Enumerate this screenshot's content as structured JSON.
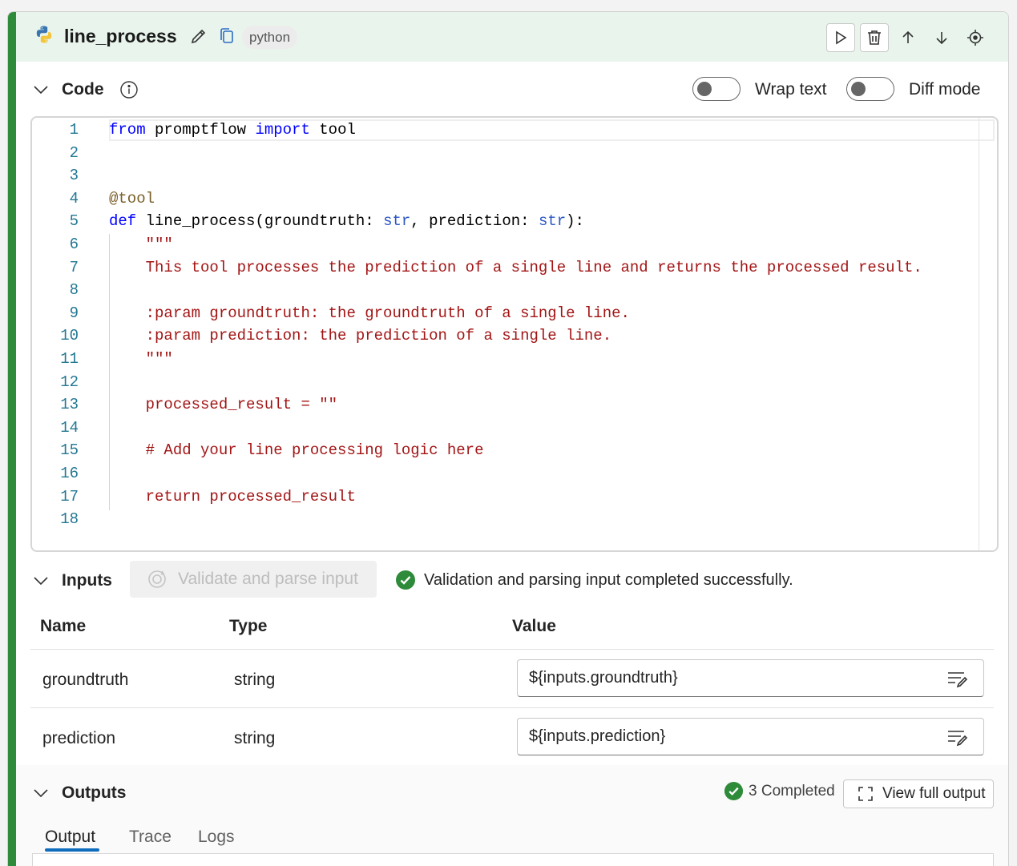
{
  "node": {
    "title": "line_process",
    "language": "python"
  },
  "code_section": {
    "title": "Code",
    "wrap_label": "Wrap text",
    "diff_label": "Diff mode",
    "wrap_on": false,
    "diff_on": false
  },
  "code_lines": [
    "from promptflow import tool",
    "",
    "",
    "@tool",
    "def line_process(groundtruth: str, prediction: str):",
    "    \"\"\"",
    "    This tool processes the prediction of a single line and returns the processed result.",
    "",
    "    :param groundtruth: the groundtruth of a single line.",
    "    :param prediction: the prediction of a single line.",
    "    \"\"\"",
    "",
    "    processed_result = \"\"",
    "",
    "    # Add your line processing logic here",
    "",
    "    return processed_result",
    ""
  ],
  "inputs_section": {
    "title": "Inputs",
    "validate_label": "Validate and parse input",
    "status": "Validation and parsing input completed successfully.",
    "columns": [
      "Name",
      "Type",
      "Value"
    ],
    "rows": [
      {
        "name": "groundtruth",
        "type": "string",
        "value": "${inputs.groundtruth}"
      },
      {
        "name": "prediction",
        "type": "string",
        "value": "${inputs.prediction}"
      }
    ]
  },
  "outputs_section": {
    "title": "Outputs",
    "completed": "3 Completed",
    "view_full": "View full output",
    "tabs": [
      "Output",
      "Trace",
      "Logs"
    ],
    "active_tab": "Output"
  },
  "colors": {
    "accent": "#2e8b3a",
    "header_bg": "#e9f5ec",
    "success": "#2e8b3a",
    "tab_underline": "#0f6cbd"
  }
}
